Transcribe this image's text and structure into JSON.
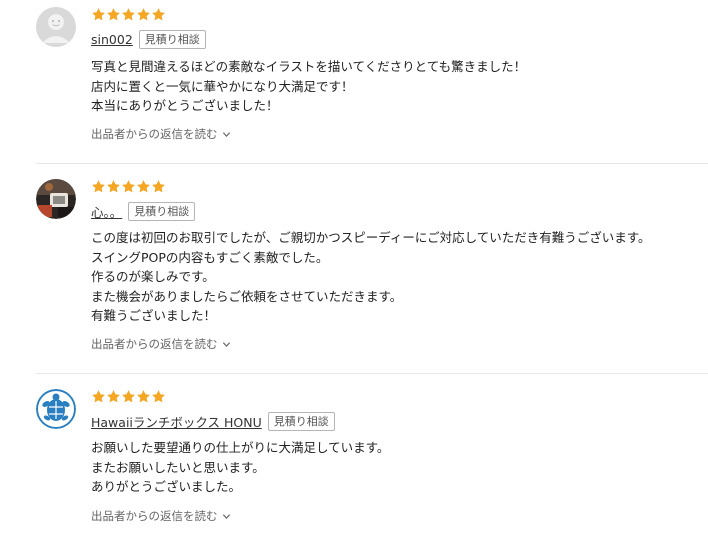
{
  "colors": {
    "star": "#f5a623",
    "divider": "#e6e6e6"
  },
  "reviews": [
    {
      "rating": 5,
      "avatar_icon": "default-face-icon",
      "user_name": "sin002",
      "badge": "見積り相談",
      "lines": [
        "写真と見間違えるほどの素敵なイラストを描いてくださりとても驚きました！",
        "店内に置くと一気に華やかになり大満足です！",
        "本当にありがとうございました！"
      ],
      "reply_label": "出品者からの返信を読む"
    },
    {
      "rating": 5,
      "avatar_icon": "photo-avatar-icon",
      "user_name": "心。。",
      "badge": "見積り相談",
      "lines": [
        "この度は初回のお取引でしたが、ご親切かつスピーディーにご対応していただき有難うございます。",
        "スイングPOPの内容もすごく素敵でした。",
        "作るのが楽しみです。",
        "また機会がありましたらご依頼をさせていただきます。",
        "有難うございました！"
      ],
      "reply_label": "出品者からの返信を読む"
    },
    {
      "rating": 5,
      "avatar_icon": "turtle-logo-icon",
      "user_name": "Hawaiiランチボックス HONU",
      "badge": "見積り相談",
      "lines": [
        "お願いした要望通りの仕上がりに大満足しています。",
        "またお願いしたいと思います。",
        "ありがとうございました。"
      ],
      "reply_label": "出品者からの返信を読む"
    }
  ]
}
